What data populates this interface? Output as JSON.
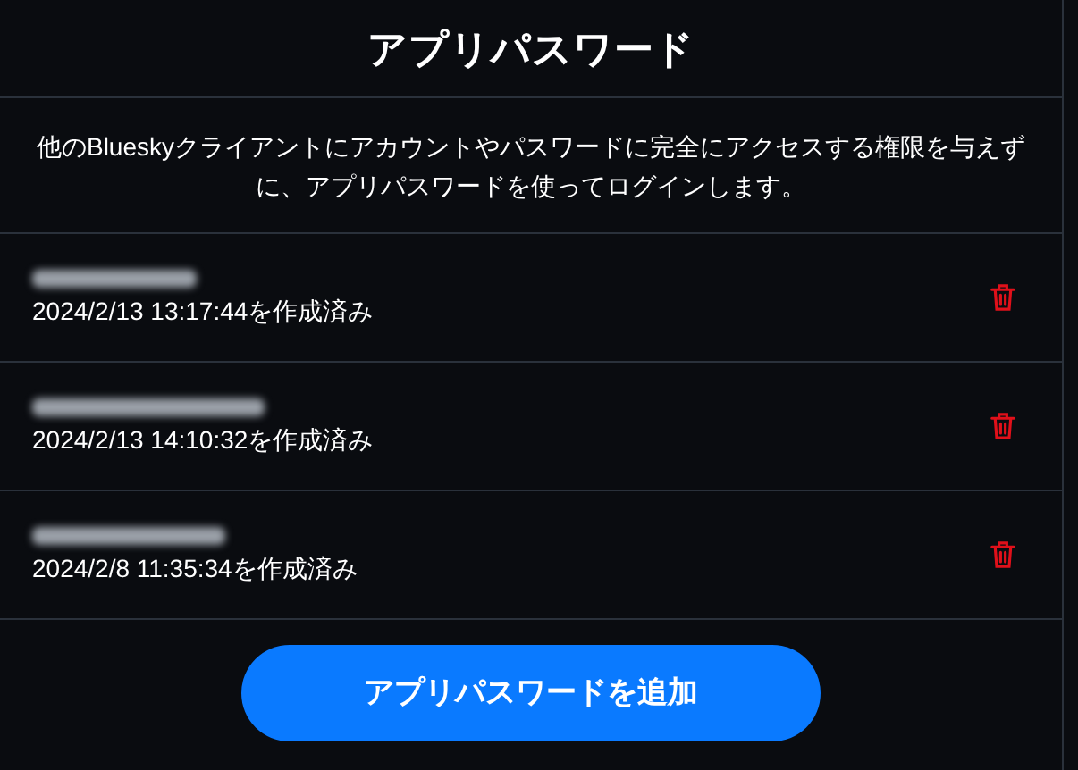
{
  "title": "アプリパスワード",
  "description": "他のBlueskyクライアントにアカウントやパスワードに完全にアクセスする権限を与えずに、アプリパスワードを使ってログインします。",
  "passwords": [
    {
      "created": "2024/2/13 13:17:44を作成済み"
    },
    {
      "created": "2024/2/13 14:10:32を作成済み"
    },
    {
      "created": "2024/2/8 11:35:34を作成済み"
    }
  ],
  "add_button": "アプリパスワードを追加"
}
